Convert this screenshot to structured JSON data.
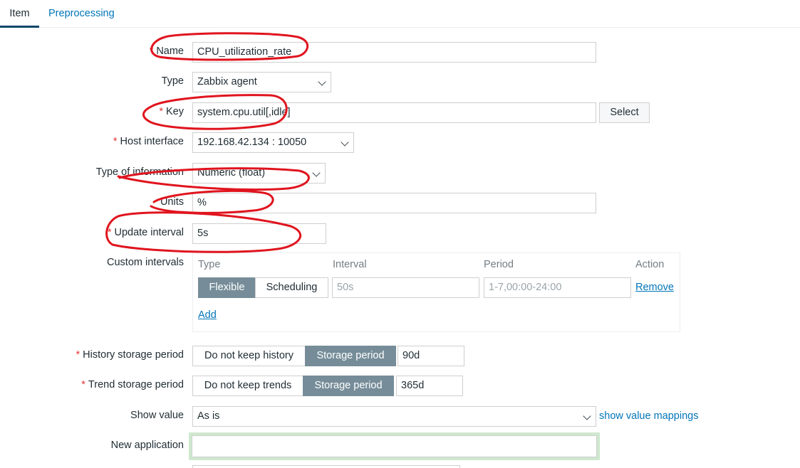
{
  "tabs": [
    "Item",
    "Preprocessing"
  ],
  "form": {
    "name": {
      "label": "Name",
      "value": "CPU_utilization_rate"
    },
    "type": {
      "label": "Type",
      "value": "Zabbix agent"
    },
    "key": {
      "label": "Key",
      "value": "system.cpu.util[,idle]",
      "button": "Select"
    },
    "host_interface": {
      "label": "Host interface",
      "value": "192.168.42.134 : 10050"
    },
    "type_of_information": {
      "label": "Type of information",
      "value": "Numeric (float)"
    },
    "units": {
      "label": "Units",
      "value": "%"
    },
    "update_interval": {
      "label": "Update interval",
      "value": "5s"
    },
    "custom_intervals": {
      "label": "Custom intervals",
      "columns": [
        "Type",
        "Interval",
        "Period",
        "Action"
      ],
      "row": {
        "type_options": [
          "Flexible",
          "Scheduling"
        ],
        "interval_placeholder": "50s",
        "period_placeholder": "1-7,00:00-24:00",
        "action": "Remove"
      },
      "add": "Add"
    },
    "history": {
      "label": "History storage period",
      "options": [
        "Do not keep history",
        "Storage period"
      ],
      "value": "90d"
    },
    "trend": {
      "label": "Trend storage period",
      "options": [
        "Do not keep trends",
        "Storage period"
      ],
      "value": "365d"
    },
    "show_value": {
      "label": "Show value",
      "value": "As is",
      "link": "show value mappings"
    },
    "new_application": {
      "label": "New application",
      "value": ""
    }
  },
  "colors": {
    "link": "#0275b8",
    "required": "#e33734",
    "toggle_active": "#768d99",
    "annotation": "#e0141e"
  }
}
